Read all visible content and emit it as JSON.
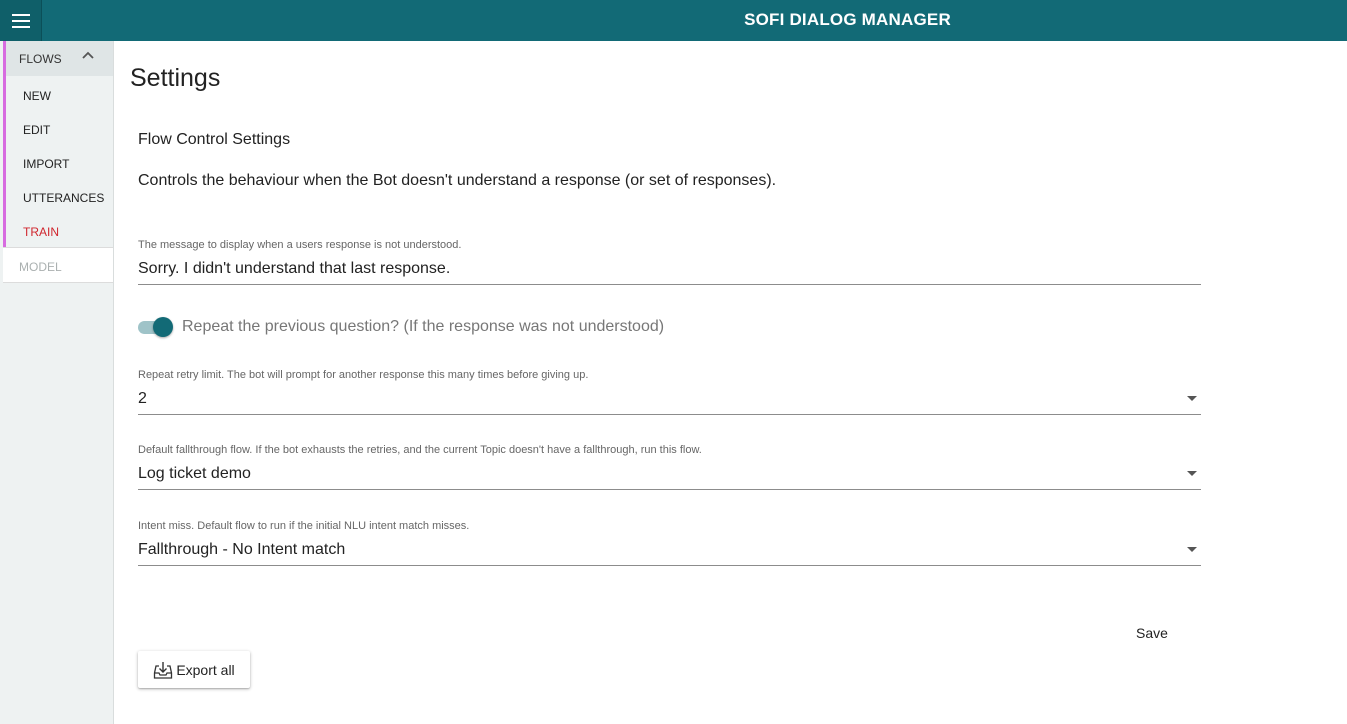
{
  "app": {
    "title": "SOFI DIALOG MANAGER",
    "accent": "#126a76",
    "menu_icon": "hamburger-menu-icon"
  },
  "sidebar": {
    "flows_label": "FLOWS",
    "items": [
      {
        "label": "NEW"
      },
      {
        "label": "EDIT"
      },
      {
        "label": "IMPORT"
      },
      {
        "label": "UTTERANCES"
      },
      {
        "label": "TRAIN",
        "active": true
      }
    ],
    "model_label": "MODEL",
    "highlight_color": "#d76ce0"
  },
  "page": {
    "title": "Settings",
    "section_title": "Flow Control Settings",
    "section_desc": "Controls the behaviour when the Bot doesn't understand a response (or set of responses)."
  },
  "form": {
    "not_understood": {
      "label": "The message to display when a users response is not understood.",
      "value": "Sorry. I didn't understand that last response."
    },
    "repeat_toggle": {
      "label": "Repeat the previous question? (If the response was not understood)",
      "checked": true
    },
    "retry_limit": {
      "label": "Repeat retry limit. The bot will prompt for another response this many times before giving up.",
      "value": "2"
    },
    "fallthrough_flow": {
      "label": "Default fallthrough flow. If the bot exhausts the retries, and the current Topic doesn't have a fallthrough, run this flow.",
      "value": "Log ticket demo"
    },
    "intent_miss": {
      "label": "Intent miss. Default flow to run if the initial NLU intent match misses.",
      "value": "Fallthrough - No Intent match"
    }
  },
  "actions": {
    "save_label": "Save",
    "export_label": "Export all",
    "export_icon": "export-icon"
  }
}
